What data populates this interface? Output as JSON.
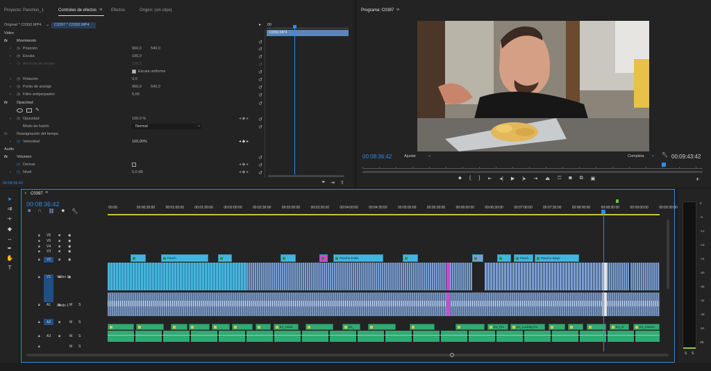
{
  "tabs": {
    "project": "Proyecto: Panchos_1",
    "effects_controls": "Controles de efectos",
    "effects": "Efectos",
    "source": "Origen: (sin clips)",
    "program": "Programa: C0397"
  },
  "effect_controls": {
    "master_clip": "Original * C0392.MP4",
    "sequence_clip": "C0397 * C0392.MP4",
    "mini_timecode": "00",
    "clip_bar_label": "C0392.MP4",
    "section_video": "Video",
    "movement": "Movimiento",
    "position_label": "Posición",
    "position_x": "960,0",
    "position_y": "540,0",
    "scale_label": "Escala",
    "scale_value": "100,0",
    "scale_width_label": "Anchura de escala",
    "scale_width_value": "100,0",
    "uniform_scale": "Escala uniforme",
    "rotation_label": "Rotación",
    "rotation_value": "0,0",
    "anchor_label": "Punto de anclaje",
    "anchor_x": "960,0",
    "anchor_y": "540,0",
    "antiflicker_label": "Filtro antiparpadeo",
    "antiflicker_value": "0,00",
    "opacity": "Opacidad",
    "opacity_label": "Opacidad",
    "opacity_value": "100,0 %",
    "blend_label": "Modo de fusión",
    "blend_value": "Normal",
    "time_remap": "Reasignación del tiempo",
    "speed_label": "Velocidad",
    "speed_value": "100,00%",
    "section_audio": "Audio",
    "volume": "Volumen",
    "bypass_label": "Derivar",
    "level_label": "Nivel",
    "level_value": "0,0 dB",
    "timecode": "00:08:36:42"
  },
  "program_monitor": {
    "timecode": "00:08:36:42",
    "fit": "Ajustar",
    "quality": "Completa",
    "duration": "00:09:43:42"
  },
  "timeline": {
    "sequence_tab": "C0397",
    "timecode": "00:08:36:42",
    "ruler": [
      ":00:00",
      "00:00:30:00",
      "00:01:00:00",
      "00:01:30:00",
      "00:02:00:00",
      "00:02:30:00",
      "00:03:00:00",
      "00:03:30:00",
      "00:04:00:00",
      "00:04:30:00",
      "00:05:00:00",
      "00:05:30:00",
      "00:06:00:00",
      "00:06:30:00",
      "00:07:00:00",
      "00:07:30:00",
      "00:08:00:00",
      "00:08:30:00",
      "00:09:00:00",
      "00:09:30:00"
    ],
    "video_tracks": [
      "V6",
      "V5",
      "V4",
      "V3",
      "V2",
      "V1"
    ],
    "audio_tracks": [
      "A1",
      "A2",
      "A3"
    ],
    "video1_name": "Vídeo 1",
    "audio1_name": "Audio 1",
    "mute": "M",
    "solo": "S",
    "v2_clips": [
      "Panch",
      "Pancho Estilo",
      "Panch",
      "Pancho diego"
    ],
    "a2_clips": [
      "E1_Hace",
      "E1_",
      "E1_Pro",
      "E1_Looking for",
      "E1_H",
      "E1_Hacien"
    ]
  },
  "meter": {
    "scale": [
      "0",
      "-6",
      "-12",
      "-18",
      "-24",
      "-30",
      "-36",
      "-42",
      "-48",
      "-54",
      "dB"
    ],
    "solo_left": "S",
    "solo_right": "S"
  }
}
